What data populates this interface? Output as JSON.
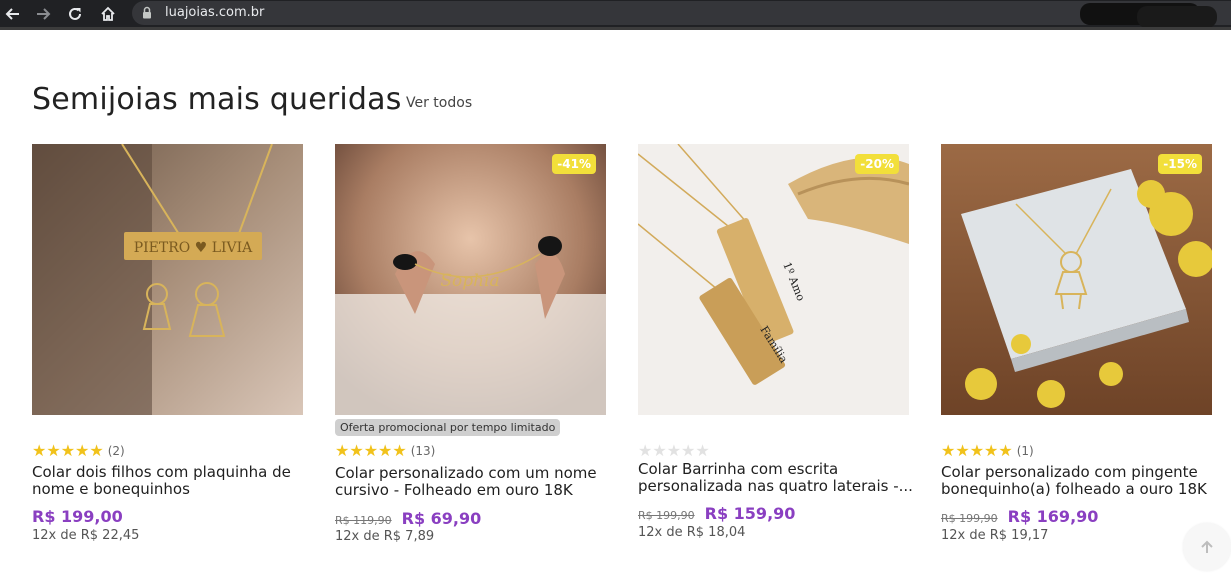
{
  "browser": {
    "url": "luajoias.com.br"
  },
  "section": {
    "title": "Semijoias mais queridas",
    "see_all": "Ver todos"
  },
  "products": [
    {
      "name": "Colar dois filhos com plaquinha de\nnome e bonequinhos",
      "rating_count": "(2)",
      "price": "R$ 199,00",
      "installments": "12x de R$ 22,45",
      "image_text": "PIETRO ♥ LIVIA"
    },
    {
      "discount": "-41%",
      "promo": "Oferta promocional por tempo limitado",
      "name": "Colar personalizado com um nome\ncursivo - Folheado em ouro 18K",
      "rating_count": "(13)",
      "old_price": "R$ 119,90",
      "price": "R$ 69,90",
      "installments": "12x de R$ 7,89",
      "image_text": "Sophia"
    },
    {
      "discount": "-20%",
      "name": "Colar Barrinha com escrita\npersonalizada nas quatro laterais -...",
      "old_price": "R$ 199,90",
      "price": "R$ 159,90",
      "installments": "12x de R$ 18,04",
      "image_text_1": "1º Amo",
      "image_text_2": "Família"
    },
    {
      "discount": "-15%",
      "name": "Colar personalizado com pingente\nbonequinho(a) folheado a ouro 18K",
      "rating_count": "(1)",
      "old_price": "R$ 199,90",
      "price": "R$ 169,90",
      "installments": "12x de R$ 19,17"
    }
  ],
  "colors": {
    "price": "#8a3fc1",
    "star": "#f1c21b",
    "discount_badge": "#f2df3a"
  }
}
